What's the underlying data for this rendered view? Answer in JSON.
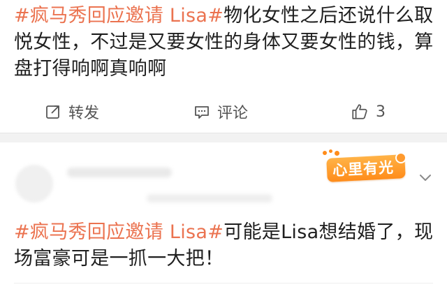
{
  "post1": {
    "topic": "#疯马秀回应邀请 Lisa#",
    "text": "物化女性之后还说什么取悦女性，不过是又要女性的身体又要女性的钱，算盘打得响啊真响啊",
    "actions": {
      "forward_label": "转发",
      "comment_label": "评论",
      "like_count": "3"
    }
  },
  "post2": {
    "badge_text": "心里有光",
    "topic": "#疯马秀回应邀请 Lisa#",
    "text": "可能是Lisa想结婚了，现场富豪可是一抓一大把！"
  },
  "colors": {
    "topic": "#eb7350",
    "badge": "#ff8c1a",
    "divider": "#f2f2f2"
  },
  "icons": {
    "forward": "share-arrow-icon",
    "comment": "comment-bubble-icon",
    "like": "thumbs-up-icon",
    "more": "chevron-down-icon"
  }
}
